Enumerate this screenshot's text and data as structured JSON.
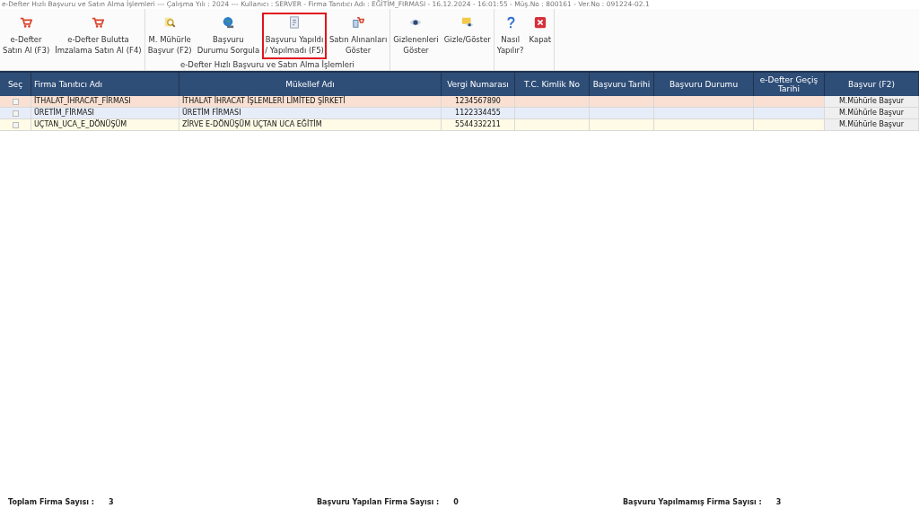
{
  "window": {
    "title": "e-Defter Hızlı Başvuru ve Satın Alma İşlemleri  ---  Çalışma Yılı : 2024  ---  Kullanıcı : SERVER - Firma Tanıtıcı Adı : EĞİTİM_FIRMASI - 16.12.2024 - 16:01:55 - Müş.No : 800161 - Ver.No : 091224-02.1"
  },
  "toolbar": {
    "groups": [
      {
        "buttons": [
          {
            "kind": "cart",
            "label": "e-Defter\nSatın Al (F3)",
            "highlighted": false
          },
          {
            "kind": "cart",
            "label": "e-Defter Bulutta\nİmzalama Satın Al (F4)",
            "highlighted": false
          }
        ]
      },
      {
        "label": "e-Defter Hızlı Başvuru ve Satın Alma İşlemleri",
        "buttons": [
          {
            "kind": "seal",
            "label": "M. Mühürle\nBaşvur (F2)",
            "highlighted": false
          },
          {
            "kind": "globe",
            "label": "Başvuru\nDurumu Sorgula",
            "highlighted": false
          },
          {
            "kind": "document",
            "label": "Başvuru Yapıldı\n/ Yapılmadı (F5)",
            "highlighted": true
          },
          {
            "kind": "cart-doc",
            "label": "Satın Alınanları\nGöster",
            "highlighted": false
          }
        ]
      },
      {
        "buttons": [
          {
            "kind": "eye",
            "label": "Gizlenenleri\nGöster",
            "highlighted": false
          },
          {
            "kind": "eye-card",
            "label": "Gizle/Göster",
            "highlighted": false
          }
        ]
      },
      {
        "buttons": [
          {
            "kind": "help",
            "label": "Nasıl\nYapılır?",
            "highlighted": false
          },
          {
            "kind": "close",
            "label": "Kapat",
            "highlighted": false
          }
        ]
      }
    ]
  },
  "table": {
    "columns": [
      "Seç",
      "Firma Tanıtıcı Adı",
      "Mükellef Adı",
      "Vergi Numarası",
      "T.C. Kimlik No",
      "Başvuru Tarihi",
      "Başvuru Durumu",
      "e-Defter Geçiş\nTarihi",
      "Başvur (F2)"
    ],
    "rows": [
      {
        "selected": true,
        "checked": false,
        "firma": "İTHALAT_İHRACAT_FİRMASI",
        "mukellef": "İTHALAT İHRACAT İŞLEMLERİ LİMİTED ŞİRKETİ",
        "vergi": "1234567890",
        "action": "M.Mühürle Başvur"
      },
      {
        "selected": false,
        "checked": false,
        "firma": "ÜRETİM_FİRMASI",
        "mukellef": "ÜRETİM FİRMASI",
        "vergi": "1122334455",
        "action": "M.Mühürle Başvur"
      },
      {
        "selected": false,
        "checked": false,
        "firma": "UÇTAN_UCA_E_DÖNÜŞÜM",
        "mukellef": "ZİRVE E-DÖNÜŞÜM UÇTAN UCA EĞİTİM",
        "vergi": "5544332211",
        "action": "M.Mühürle Başvur"
      }
    ]
  },
  "status_bar": [
    {
      "label": "Toplam Firma Sayısı :",
      "value": "3"
    },
    {
      "label": "Başvuru Yapılan Firma Sayısı :",
      "value": "0"
    },
    {
      "label": "Başvuru Yapılmamış Firma Sayısı :",
      "value": "3"
    }
  ]
}
